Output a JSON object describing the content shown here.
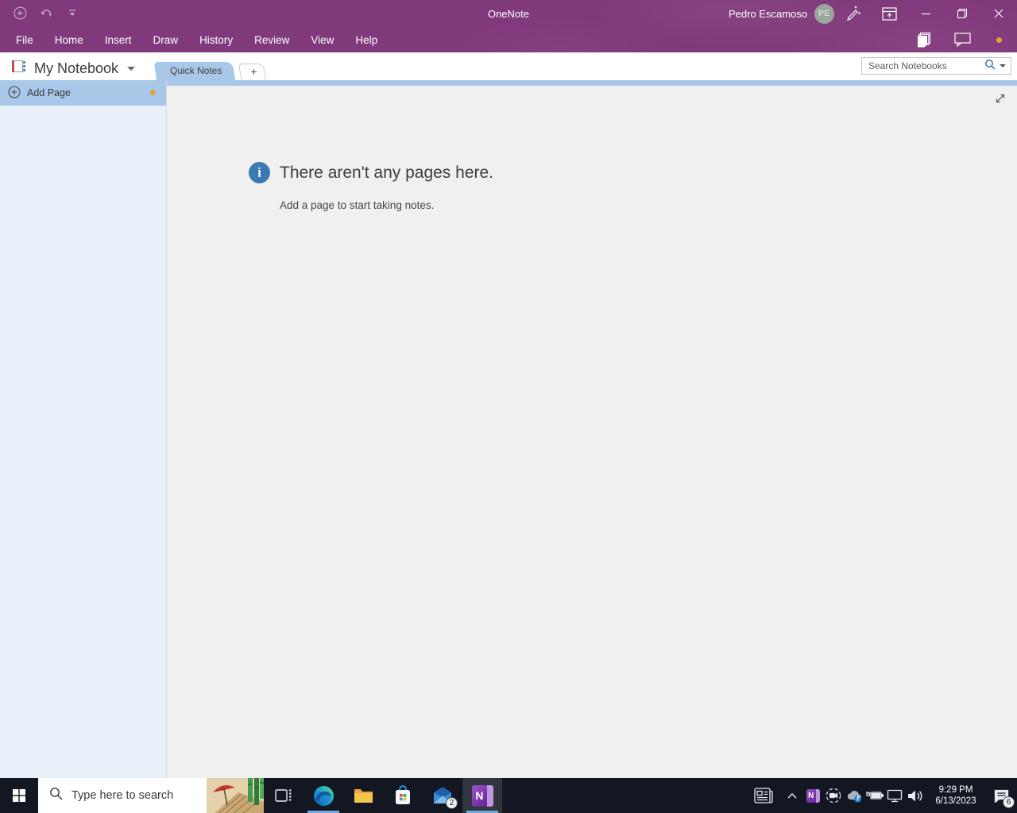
{
  "colors": {
    "titlebar_purple": "#80397B",
    "section_blue": "#A9C7E8",
    "sidebar_blue": "#E7EFF8",
    "canvas_gray": "#F0F0F0",
    "info_blue": "#3C79B3",
    "coachmark_orange": "#DFA53C",
    "taskbar_dark": "#131722"
  },
  "titlebar": {
    "app_title": "OneNote",
    "user_name": "Pedro Escamoso",
    "user_initials": "PE"
  },
  "menubar": {
    "items": [
      "File",
      "Home",
      "Insert",
      "Draw",
      "History",
      "Review",
      "View",
      "Help"
    ]
  },
  "notebook_header": {
    "notebook_name": "My Notebook",
    "section_tabs": [
      "Quick Notes"
    ],
    "new_section_label": "+",
    "search_placeholder": "Search Notebooks"
  },
  "page_sidebar": {
    "add_page_label": "Add Page"
  },
  "canvas": {
    "info_glyph": "i",
    "empty_title": "There aren't any pages here.",
    "empty_hint": "Add a page to start taking notes."
  },
  "taskbar": {
    "search_placeholder": "Type here to search",
    "mail_badge": "2",
    "notification_badge": "6",
    "onenote_letter": "N",
    "onenote_tray_letter": "N"
  },
  "clock": {
    "time": "9:29 PM",
    "date": "6/13/2023"
  }
}
